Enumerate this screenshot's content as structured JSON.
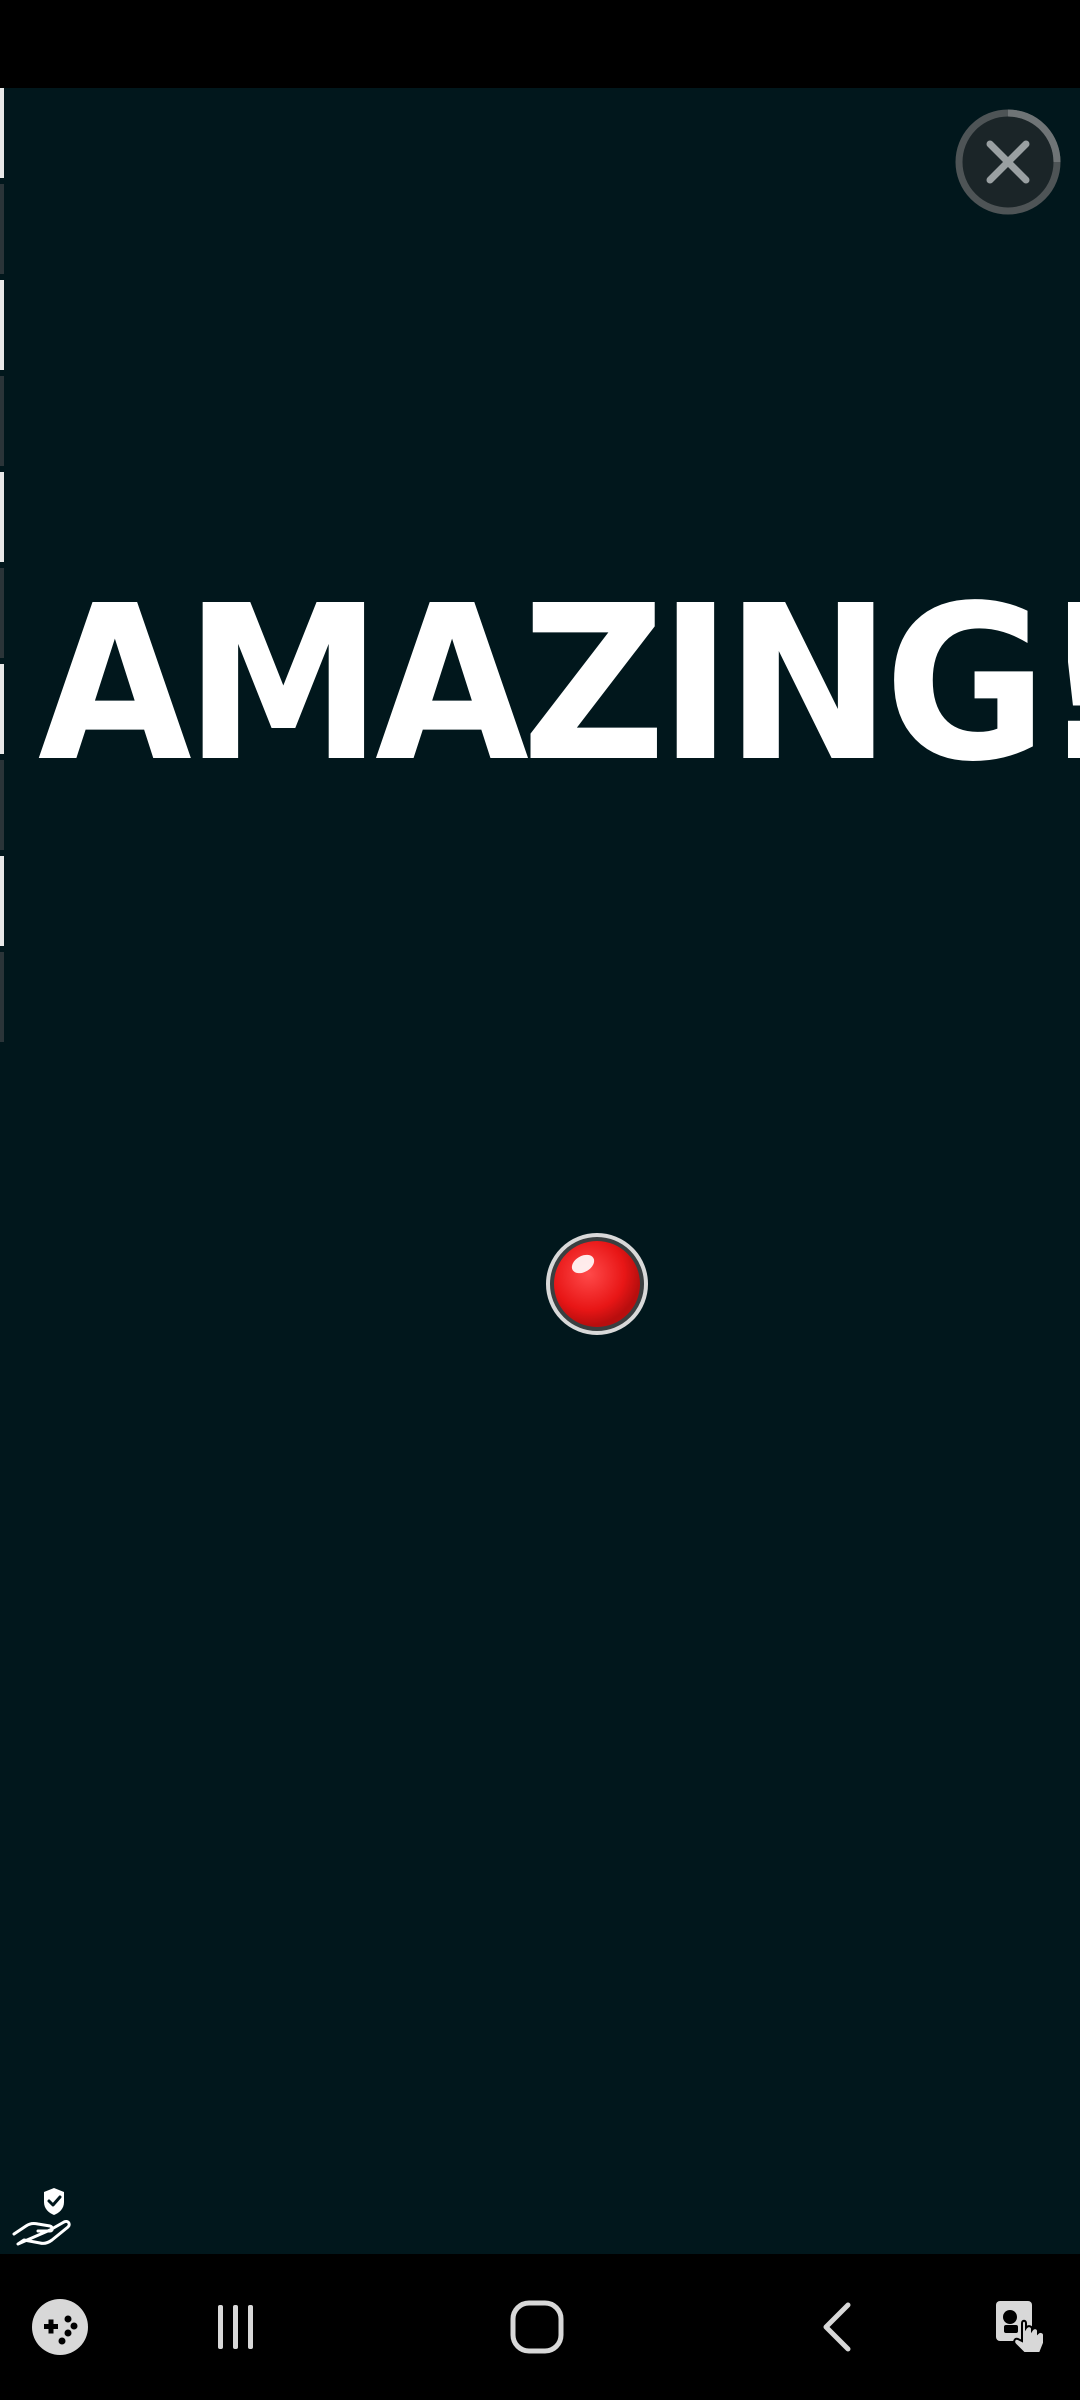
{
  "game": {
    "message": "AMAZING!",
    "close_icon": "close-icon",
    "ball_icon": "red-ball",
    "privacy_icon": "hand-shield-icon"
  },
  "colors": {
    "background": "#01171c",
    "text": "#ffffff",
    "ball": "#ee1c1c",
    "close_ring": "#5a5f60",
    "nav_bar": "#000000",
    "nav_icon": "#d8d8d8"
  },
  "navigation": {
    "items": [
      {
        "icon": "game-launcher-icon"
      },
      {
        "icon": "recent-apps-icon"
      },
      {
        "icon": "home-icon"
      },
      {
        "icon": "back-icon"
      },
      {
        "icon": "accessibility-touch-icon"
      }
    ]
  }
}
